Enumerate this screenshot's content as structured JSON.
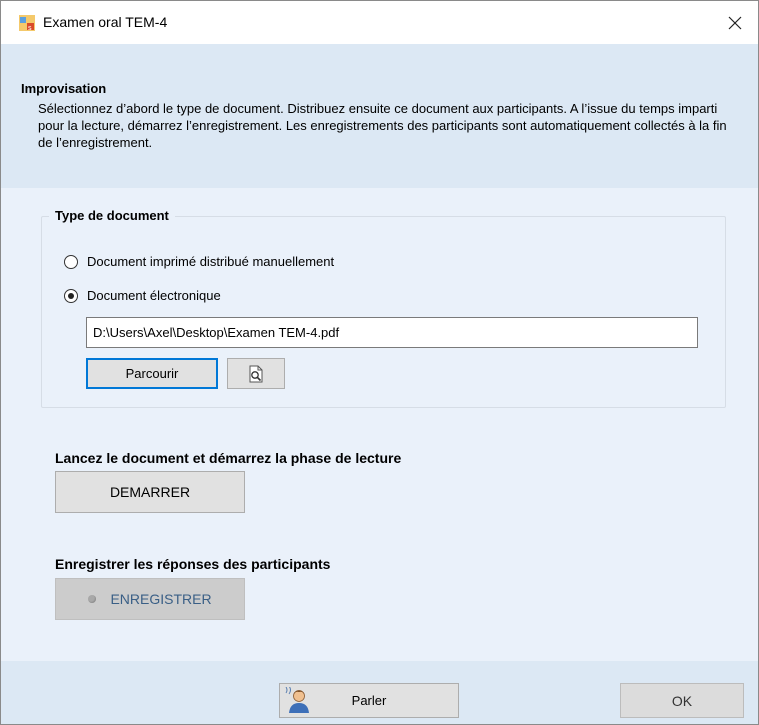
{
  "window": {
    "title": "Examen oral TEM-4",
    "close_glyph": "✕"
  },
  "header": {
    "title": "Improvisation",
    "description": "Sélectionnez d’abord le type de document. Distribuez ensuite ce document aux participants. A l’issue du temps imparti pour la lecture, démarrez l’enregistrement. Les enregistrements des participants sont automatiquement collectés à la fin de l’enregistrement."
  },
  "document_type": {
    "group_title": "Type de document",
    "options": [
      {
        "label": "Document imprimé distribué manuellement",
        "checked": false
      },
      {
        "label": "Document électronique",
        "checked": true
      }
    ],
    "file_path": "D:\\Users\\Axel\\Desktop\\Examen TEM-4.pdf",
    "browse_label": "Parcourir",
    "preview_icon": "print-preview-icon"
  },
  "reading_phase": {
    "label": "Lancez le document et démarrez la phase de lecture",
    "button_label": "DEMARRER"
  },
  "recording": {
    "label": "Enregistrer les réponses des participants",
    "button_label": "ENREGISTRER",
    "status_icon": "record-indicator-icon"
  },
  "footer": {
    "speak_label": "Parler",
    "speak_icon": "speaker-person-icon",
    "ok_label": "OK"
  },
  "colors": {
    "header_bg": "#dce8f4",
    "content_bg": "#eaf1fa",
    "focus_border": "#0078d7",
    "record_text": "#3a5f86"
  }
}
